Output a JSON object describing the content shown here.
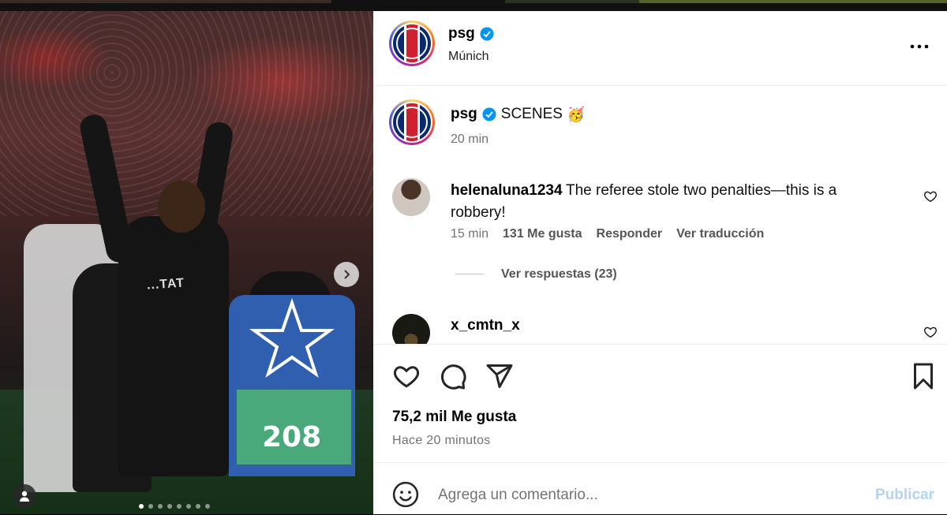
{
  "post": {
    "media": {
      "bib_number": "208",
      "jersey_text": "...TAT",
      "carousel_dots": 8,
      "active_dot": 0
    },
    "header": {
      "username": "psg",
      "verified": true,
      "location": "Múnich",
      "more_icon": "more-horizontal-icon"
    },
    "caption": {
      "username": "psg",
      "text": "SCENES",
      "emoji": "🥳",
      "time": "20 min"
    },
    "comments": [
      {
        "username": "helenaluna1234",
        "text": "The referee stole two penalties—this is a robbery!",
        "time": "15 min",
        "likes": "131 Me gusta",
        "reply": "Responder",
        "translate": "Ver traducción",
        "view_replies": "Ver respuestas (23)"
      },
      {
        "username": "x_cmtn_x"
      }
    ],
    "likes": "75,2 mil Me gusta",
    "timestamp": "Hace 20 minutos",
    "add_comment": {
      "placeholder": "Agrega un comentario...",
      "publish": "Publicar"
    },
    "colors": {
      "accent": "#0095f6",
      "publish_disabled": "#b3d3f5",
      "secondary_text": "#737373"
    }
  }
}
